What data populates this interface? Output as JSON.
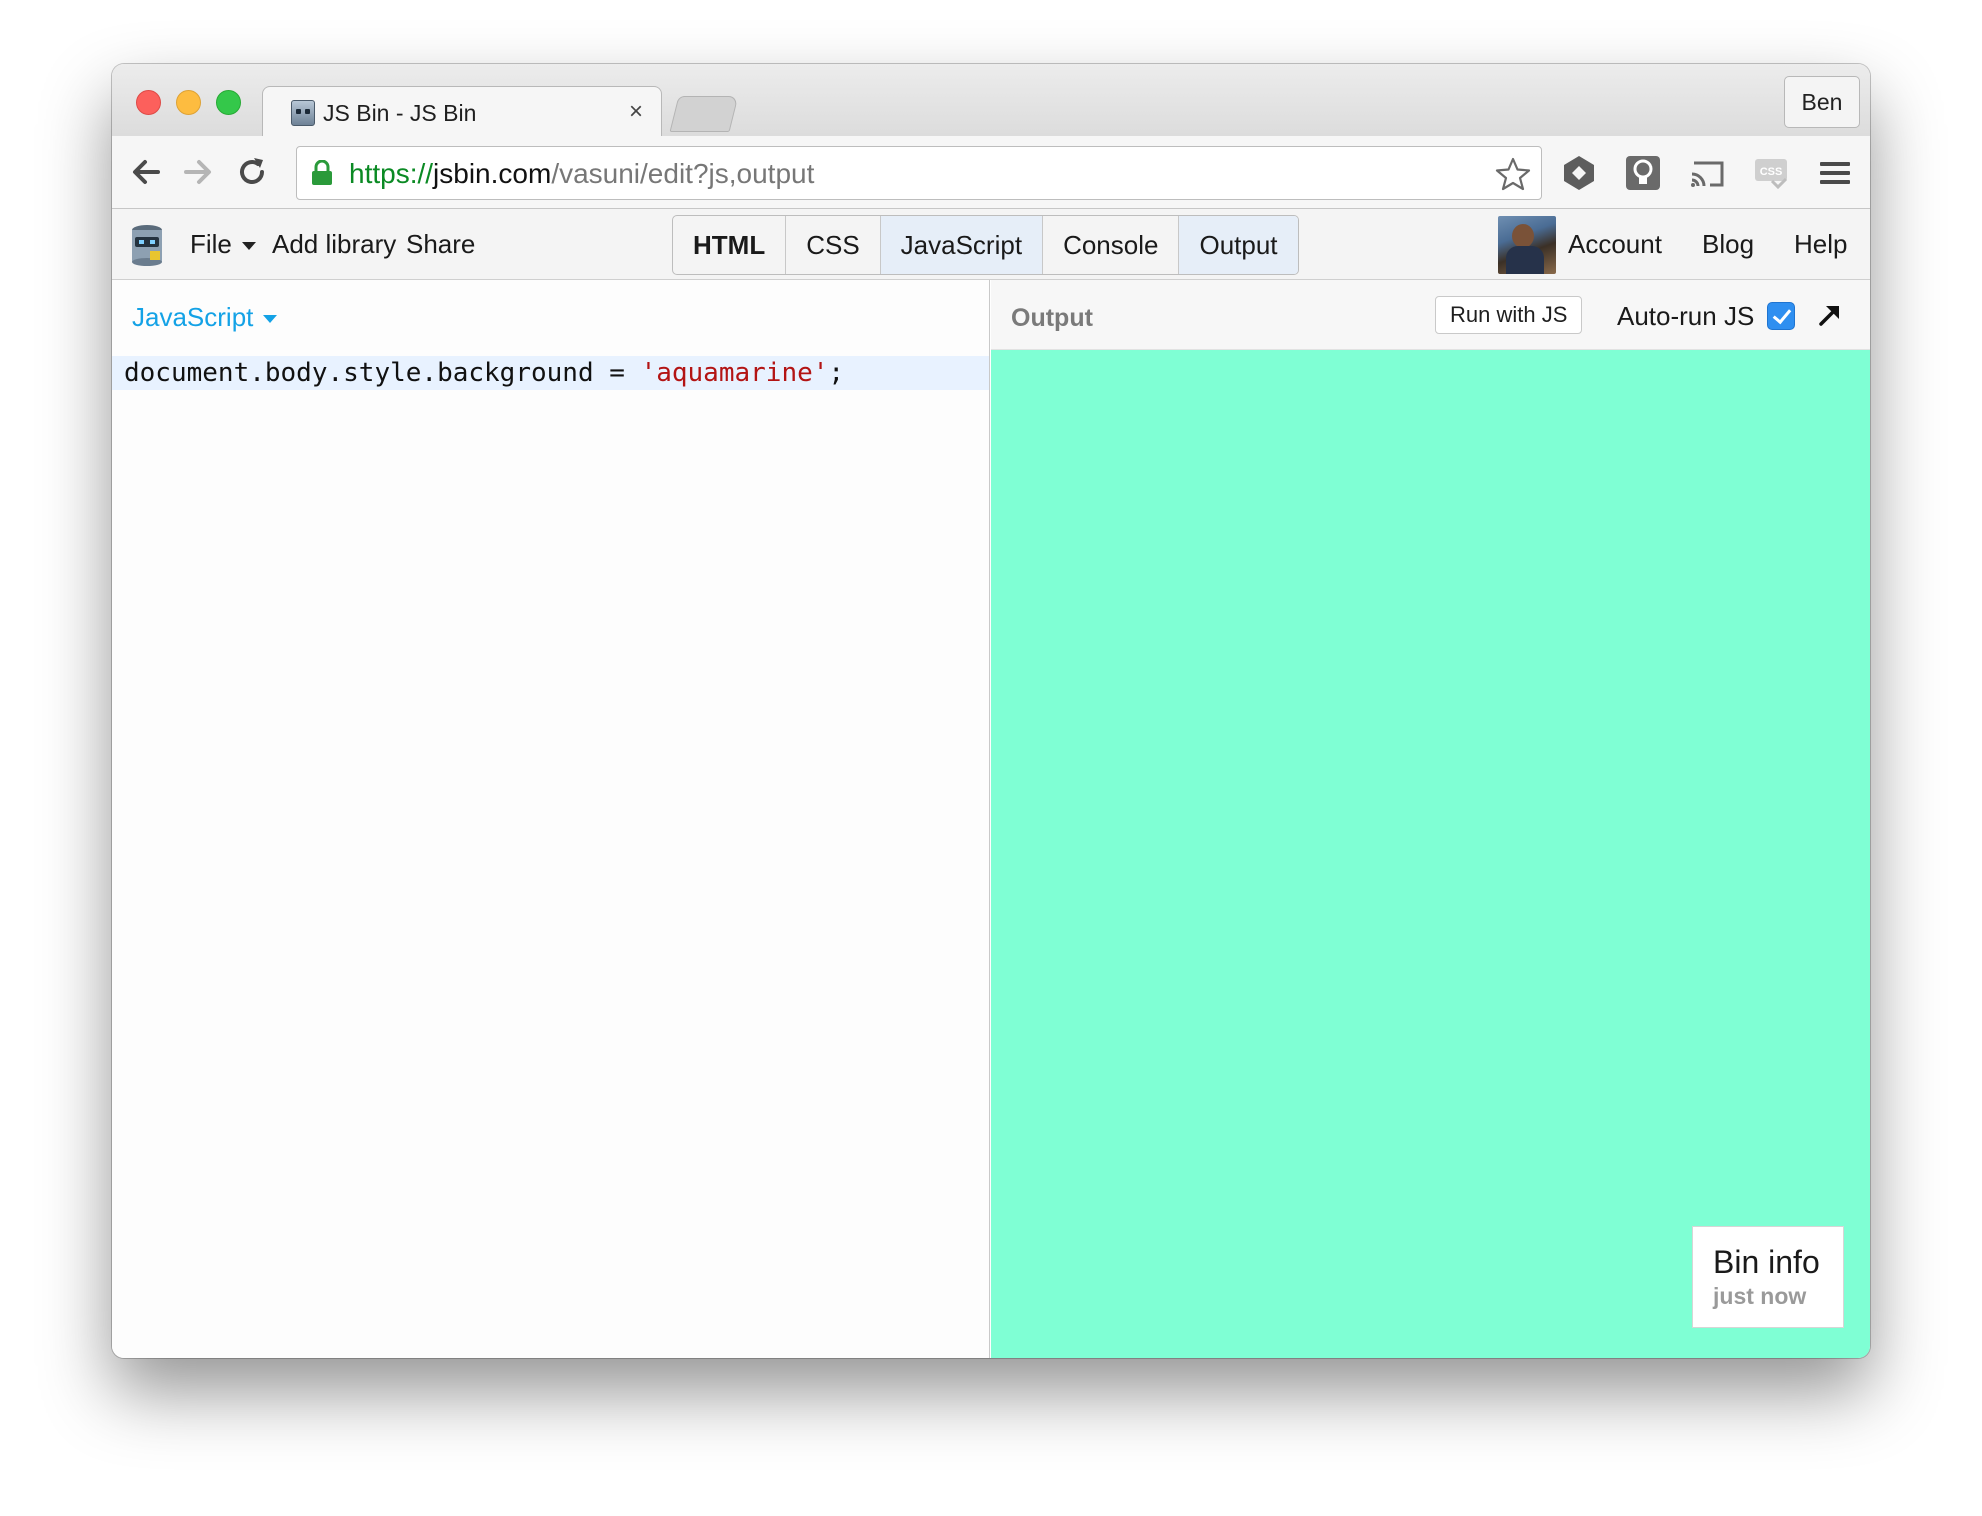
{
  "browser": {
    "tab": {
      "title": "JS Bin - JS Bin",
      "close": "×"
    },
    "profile_name": "Ben",
    "url": {
      "scheme": "https://",
      "host": "jsbin.com",
      "path": "/vasuni/edit?js,output"
    }
  },
  "app": {
    "menu": {
      "file": "File",
      "add_library": "Add library",
      "share": "Share"
    },
    "panels": [
      {
        "label": "HTML",
        "active": false
      },
      {
        "label": "CSS",
        "active": false
      },
      {
        "label": "JavaScript",
        "active": true
      },
      {
        "label": "Console",
        "active": false
      },
      {
        "label": "Output",
        "active": true
      }
    ],
    "right_menu": {
      "account": "Account",
      "blog": "Blog",
      "help": "Help"
    }
  },
  "editor": {
    "language": "JavaScript",
    "code": {
      "prefix": "document.body.style.background = ",
      "string": "'aquamarine'",
      "suffix": ";"
    }
  },
  "output": {
    "label": "Output",
    "run_button": "Run with JS",
    "autorun_label": "Auto-run JS",
    "autorun_checked": true,
    "background_color": "#7fffd4",
    "bin_info": {
      "title": "Bin info",
      "time": "just now"
    }
  },
  "colors": {
    "accent_blue": "#14a2e6",
    "url_green": "#0b8a24",
    "string_red": "#b31414"
  }
}
